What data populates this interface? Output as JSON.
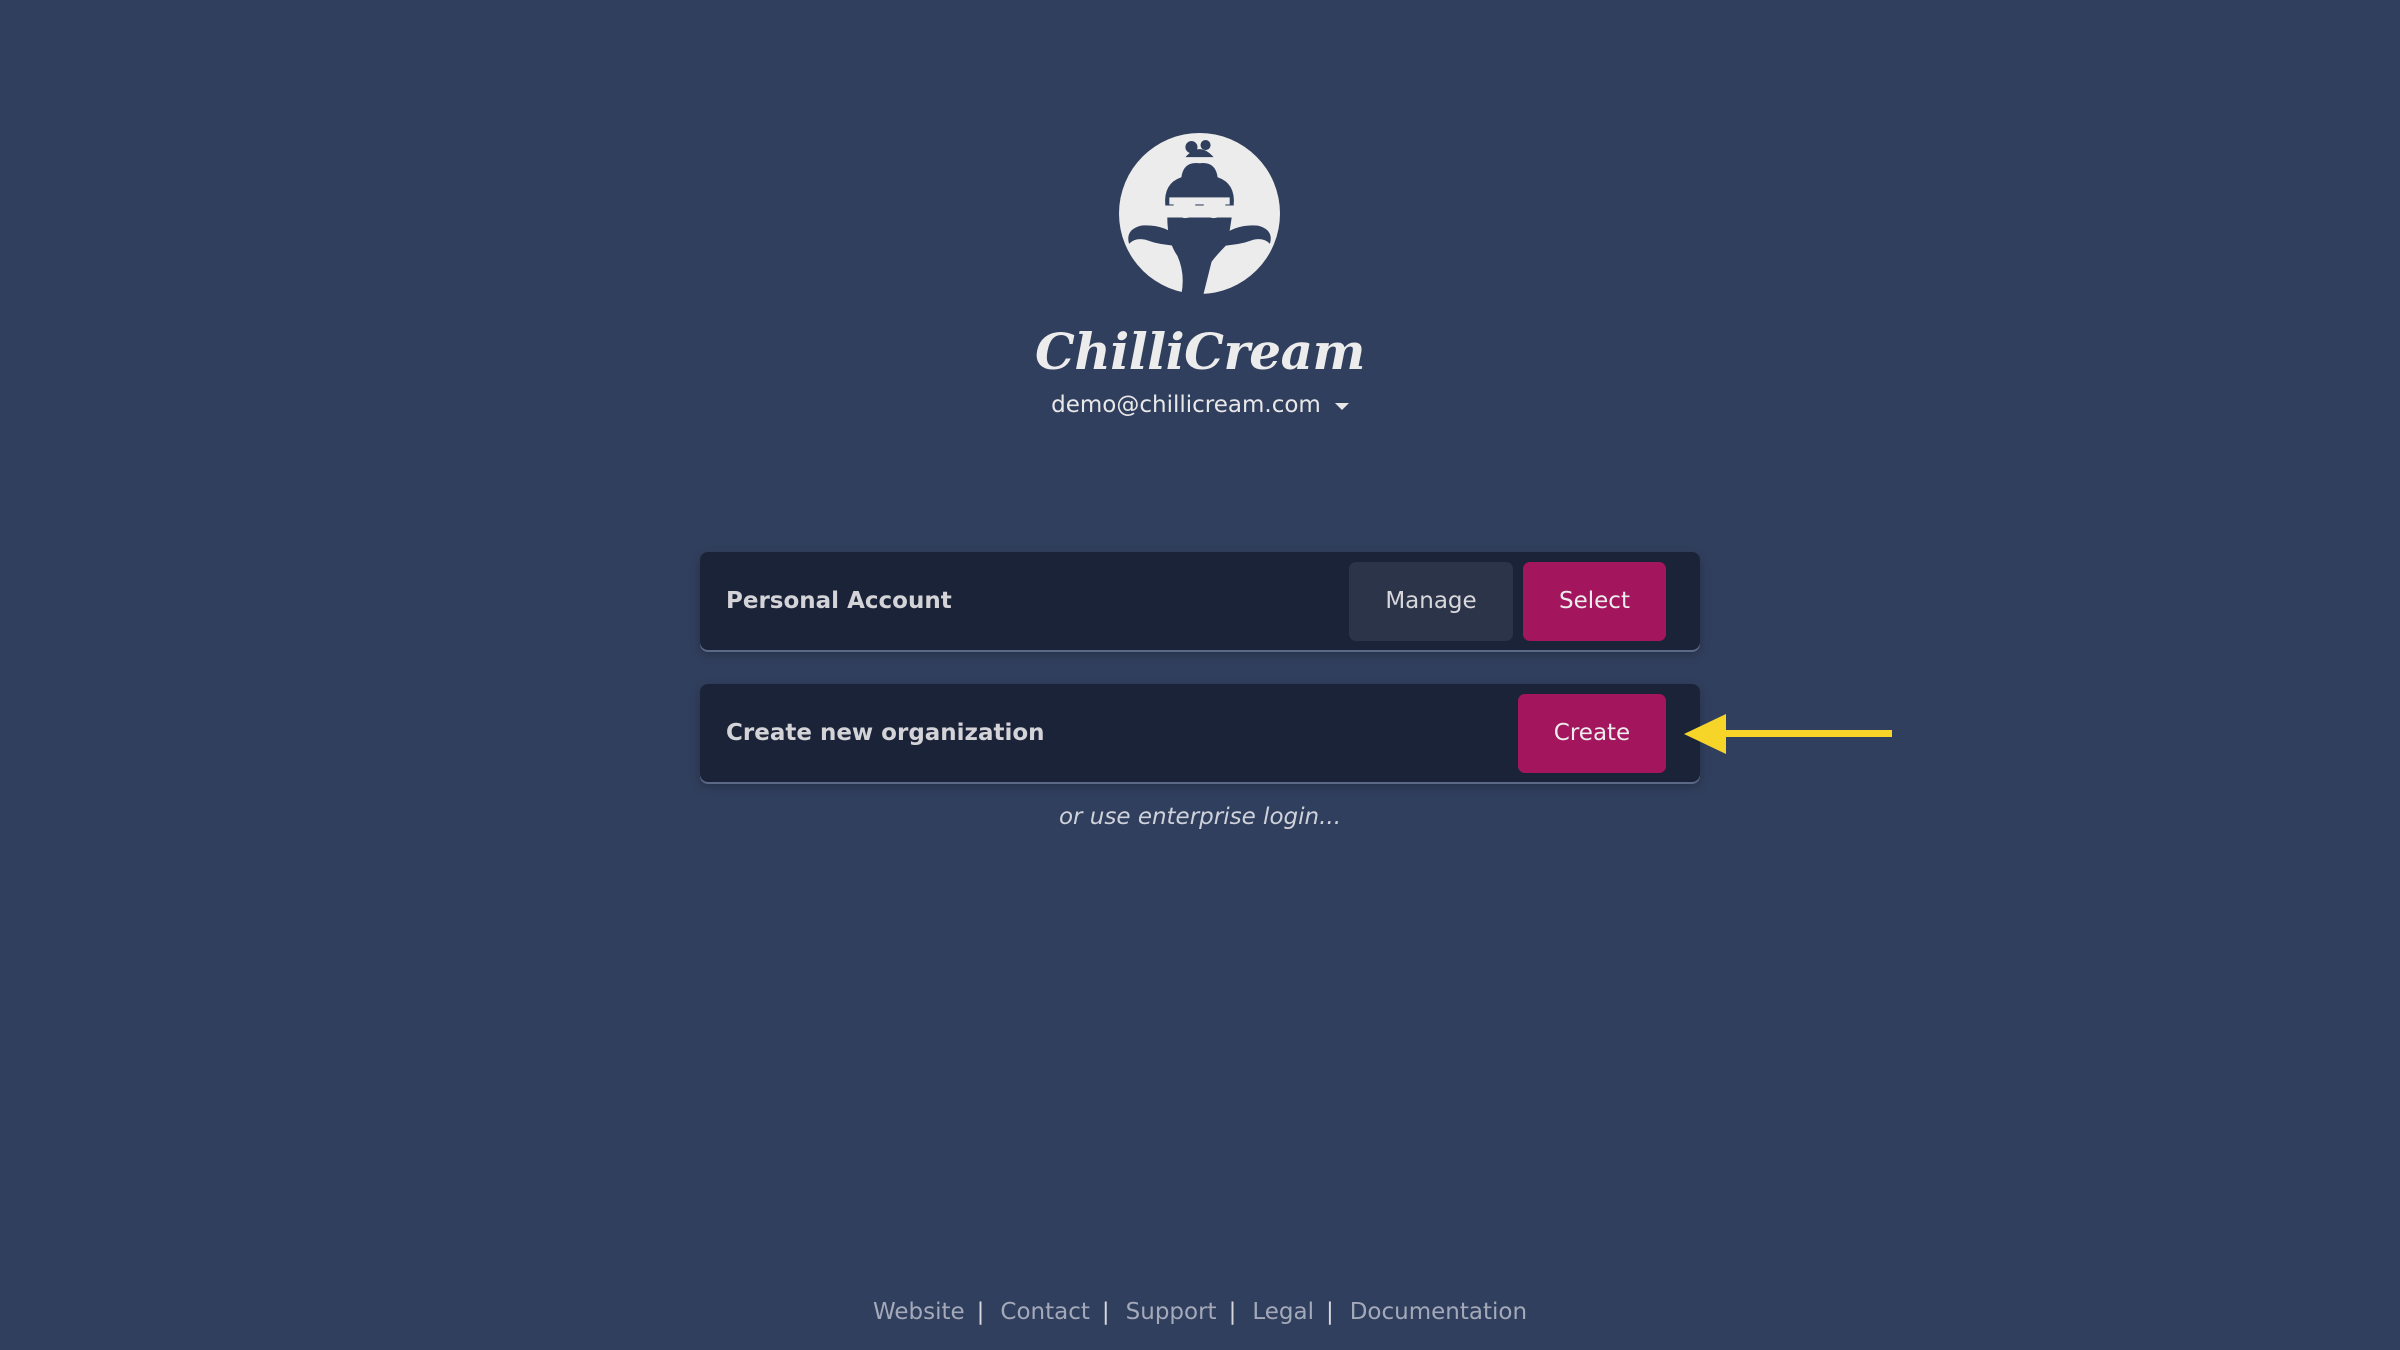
{
  "brand": {
    "name": "ChilliCream",
    "logo_icon": "chillicream-logo-icon"
  },
  "account": {
    "email": "demo@chillicream.com",
    "caret_icon": "caret-down-icon"
  },
  "cards": {
    "personal": {
      "label": "Personal Account",
      "manage_label": "Manage",
      "select_label": "Select"
    },
    "organization": {
      "label": "Create new organization",
      "create_label": "Create"
    }
  },
  "enterprise_link": "or use enterprise login...",
  "footer": {
    "links": [
      "Website",
      "Contact",
      "Support",
      "Legal",
      "Documentation"
    ],
    "separator": "|"
  },
  "colors": {
    "background": "#313f5e",
    "card": "#1b2338",
    "accent": "#a3165d",
    "secondary_button": "#2b3449",
    "annotation_arrow": "#f7d528"
  }
}
